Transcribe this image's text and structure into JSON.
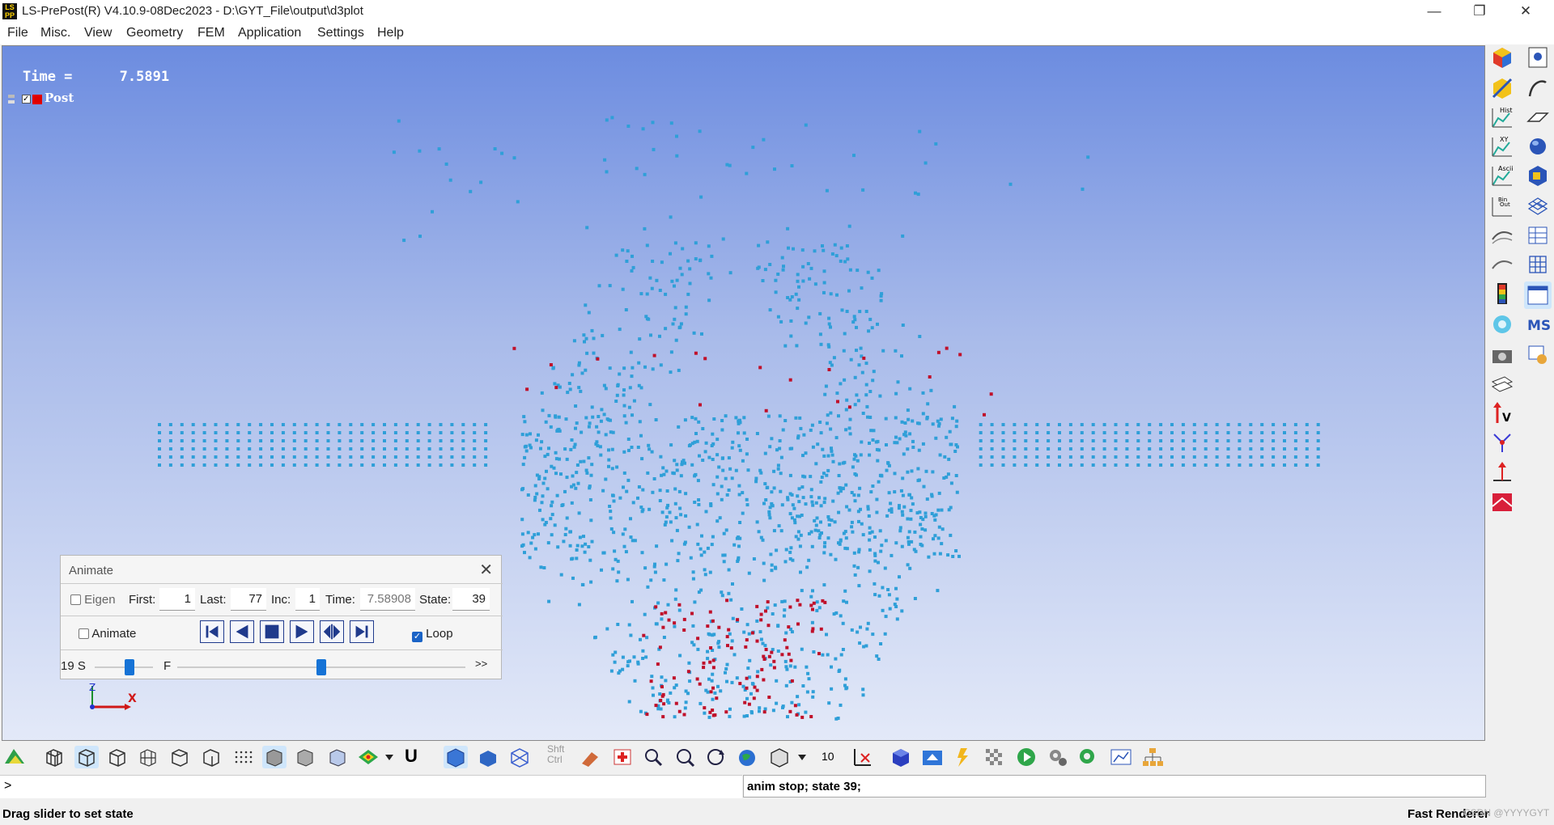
{
  "window": {
    "title": "LS-PrePost(R) V4.10.9-08Dec2023 - D:\\GYT_File\\output\\d3plot",
    "app_icon": "ls-prepost-logo",
    "minimize_icon": "minimize-icon",
    "restore_icon": "restore-icon",
    "close_icon": "close-icon"
  },
  "menu": [
    "File",
    "Misc.",
    "View",
    "Geometry",
    "FEM",
    "Application",
    "Settings",
    "Help"
  ],
  "viewport": {
    "time_label": "Time =",
    "time_value": "7.5891",
    "part_label": "Post",
    "part_color": "#e00000",
    "point_color": "#2f9fd8",
    "highlight_color": "#c0102a",
    "triad_z": "Z",
    "triad_x": "X"
  },
  "animate_dialog": {
    "title": "Animate",
    "eigen_label": "Eigen",
    "first_label": "First:",
    "first_value": "1",
    "last_label": "Last:",
    "last_value": "77",
    "inc_label": "Inc:",
    "inc_value": "1",
    "time_label": "Time:",
    "time_value": "7.58908",
    "state_label": "State:",
    "state_value": "39",
    "animate_label": "Animate",
    "loop_label": "Loop",
    "speed_label": "19 S",
    "frame_label": "F",
    "more_label": ">>",
    "speed_fraction": 0.6,
    "frame_fraction": 0.5
  },
  "toolbar": {
    "zoom_value": "10",
    "shift_ctrl_label": "Shft\nCtrl",
    "u_label": "U"
  },
  "command": {
    "prompt": ">",
    "output": "anim stop; state 39;"
  },
  "status": {
    "message": "Drag slider to set state",
    "renderer": "Fast Renderer",
    "watermark": "CSDN @YYYYGYT"
  }
}
